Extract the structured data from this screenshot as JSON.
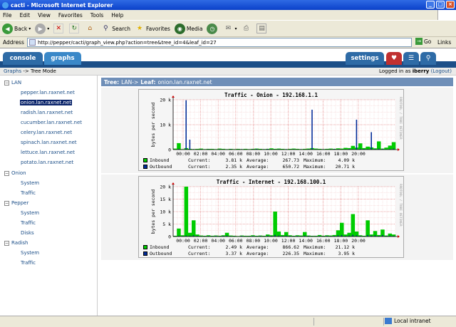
{
  "window": {
    "title": "cacti - Microsoft Internet Explorer"
  },
  "menu": [
    "File",
    "Edit",
    "View",
    "Favorites",
    "Tools",
    "Help"
  ],
  "toolbar": {
    "back": "Back",
    "search": "Search",
    "favorites": "Favorites",
    "media": "Media"
  },
  "address": {
    "label": "Address",
    "url": "http://pepper/cacti/graph_view.php?action=tree&tree_id=4&leaf_id=27",
    "go": "Go",
    "links": "Links"
  },
  "tabs": {
    "console": "console",
    "graphs": "graphs",
    "settings": "settings"
  },
  "breadcrumb": {
    "graphs": "Graphs",
    "sep": " -> ",
    "current": "Tree Mode",
    "logged_prefix": "Logged in as ",
    "user": "iberry",
    "logout": "(Logout)"
  },
  "tree": {
    "root": "LAN",
    "lan_hosts": [
      "pepper.lan.raxnet.net",
      "onion.lan.raxnet.net",
      "radish.lan.raxnet.net",
      "cucumber.lan.raxnet.net",
      "celery.lan.raxnet.net",
      "spinach.lan.raxnet.net",
      "lettuce.lan.raxnet.net",
      "potato.lan.raxnet.net"
    ],
    "selected_index": 1,
    "groups": [
      {
        "name": "Onion",
        "items": [
          "System",
          "Traffic"
        ]
      },
      {
        "name": "Pepper",
        "items": [
          "System",
          "Traffic",
          "Disks"
        ]
      },
      {
        "name": "Radish",
        "items": [
          "System",
          "Traffic"
        ]
      }
    ]
  },
  "header": {
    "tree_label": "Tree:",
    "tree_value": "LAN->",
    "leaf_label": "Leaf:",
    "leaf_value": "onion.lan.raxnet.net"
  },
  "colors": {
    "inbound": "#00cc00",
    "outbound": "#002a97",
    "header": "#6f8fb8",
    "tabbar": "#1c4f88"
  },
  "rrd_tag": "RRDTOOL / TOBI OETIKER",
  "chart_data": [
    {
      "type": "area",
      "title": "Traffic - Onion - 192.168.1.1",
      "ylabel": "bytes per second",
      "ylim": [
        0,
        20000
      ],
      "ytick_labels": [
        "0",
        "10 k",
        "20 k"
      ],
      "ytick_values": [
        0,
        10000,
        20000
      ],
      "xtick_labels": [
        "00:00",
        "02:00",
        "04:00",
        "06:00",
        "08:00",
        "10:00",
        "12:00",
        "14:00",
        "16:00",
        "18:00",
        "20:00"
      ],
      "grid": true,
      "series": [
        {
          "name": "Inbound",
          "values": [
            400,
            2600,
            200,
            600,
            300,
            200,
            300,
            400,
            200,
            300,
            300,
            200,
            400,
            300,
            200,
            300,
            200,
            300,
            200,
            300,
            200,
            300,
            400,
            300,
            200,
            300,
            500,
            300,
            400,
            300,
            200,
            300,
            400,
            300,
            200,
            300,
            400,
            600,
            400,
            300,
            200,
            300,
            400,
            300,
            500,
            400,
            700,
            600,
            1500,
            800,
            2500,
            600,
            1200,
            900,
            500,
            3300,
            400,
            800,
            1600,
            3000
          ]
        },
        {
          "name": "Outbound",
          "values": [
            0,
            300,
            100,
            19800,
            4000,
            200,
            100,
            200,
            100,
            200,
            100,
            100,
            200,
            100,
            100,
            200,
            100,
            100,
            200,
            100,
            100,
            200,
            300,
            100,
            200,
            300,
            200,
            100,
            200,
            100,
            200,
            100,
            200,
            100,
            200,
            100,
            200,
            16000,
            200,
            100,
            200,
            100,
            200,
            300,
            200,
            100,
            200,
            300,
            200,
            12000,
            400,
            300,
            200,
            7000,
            300,
            400,
            300,
            200,
            300,
            400
          ]
        }
      ],
      "legend": [
        {
          "name": "Inbound",
          "current": "3.81 k",
          "average": "267.73",
          "maximum": "4.09 k"
        },
        {
          "name": "Outbound",
          "current": "2.35 k",
          "average": "650.72",
          "maximum": "20.71 k"
        }
      ]
    },
    {
      "type": "area",
      "title": "Traffic - Internet - 192.168.100.1",
      "ylabel": "bytes per second",
      "ylim": [
        0,
        20000
      ],
      "ytick_labels": [
        "0",
        "5 k",
        "10 k",
        "15 k",
        "20 k"
      ],
      "ytick_values": [
        0,
        5000,
        10000,
        15000,
        20000
      ],
      "xtick_labels": [
        "00:00",
        "02:00",
        "04:00",
        "06:00",
        "08:00",
        "10:00",
        "12:00",
        "14:00",
        "16:00",
        "18:00",
        "20:00"
      ],
      "grid": true,
      "series": [
        {
          "name": "Inbound",
          "values": [
            300,
            3200,
            500,
            21000,
            1500,
            6500,
            800,
            400,
            300,
            500,
            300,
            400,
            300,
            500,
            1500,
            400,
            300,
            200,
            400,
            300,
            300,
            500,
            300,
            400,
            300,
            800,
            500,
            10000,
            2000,
            600,
            1800,
            500,
            300,
            500,
            400,
            1800,
            400,
            300,
            300,
            600,
            300,
            500,
            400,
            600,
            2500,
            5500,
            800,
            1500,
            9000,
            2000,
            500,
            300,
            6500,
            800,
            2200,
            600,
            2800,
            400,
            1200,
            800
          ]
        },
        {
          "name": "Outbound",
          "values": [
            200,
            300,
            200,
            400,
            300,
            500,
            300,
            200,
            200,
            300,
            200,
            300,
            200,
            300,
            400,
            200,
            200,
            100,
            300,
            200,
            200,
            300,
            200,
            300,
            200,
            400,
            300,
            700,
            400,
            300,
            400,
            300,
            200,
            300,
            200,
            400,
            300,
            200,
            200,
            300,
            200,
            300,
            200,
            300,
            500,
            600,
            300,
            400,
            700,
            500,
            300,
            200,
            600,
            400,
            500,
            300,
            600,
            300,
            400,
            300
          ]
        }
      ],
      "legend": [
        {
          "name": "Inbound",
          "current": "2.49 k",
          "average": "866.62",
          "maximum": "21.12 k"
        },
        {
          "name": "Outbound",
          "current": "3.37 k",
          "average": "226.35",
          "maximum": "3.95 k"
        }
      ]
    }
  ],
  "legend_labels": {
    "current": "Current:",
    "average": "Average:",
    "maximum": "Maximum:"
  },
  "status": {
    "zone": "Local intranet"
  }
}
